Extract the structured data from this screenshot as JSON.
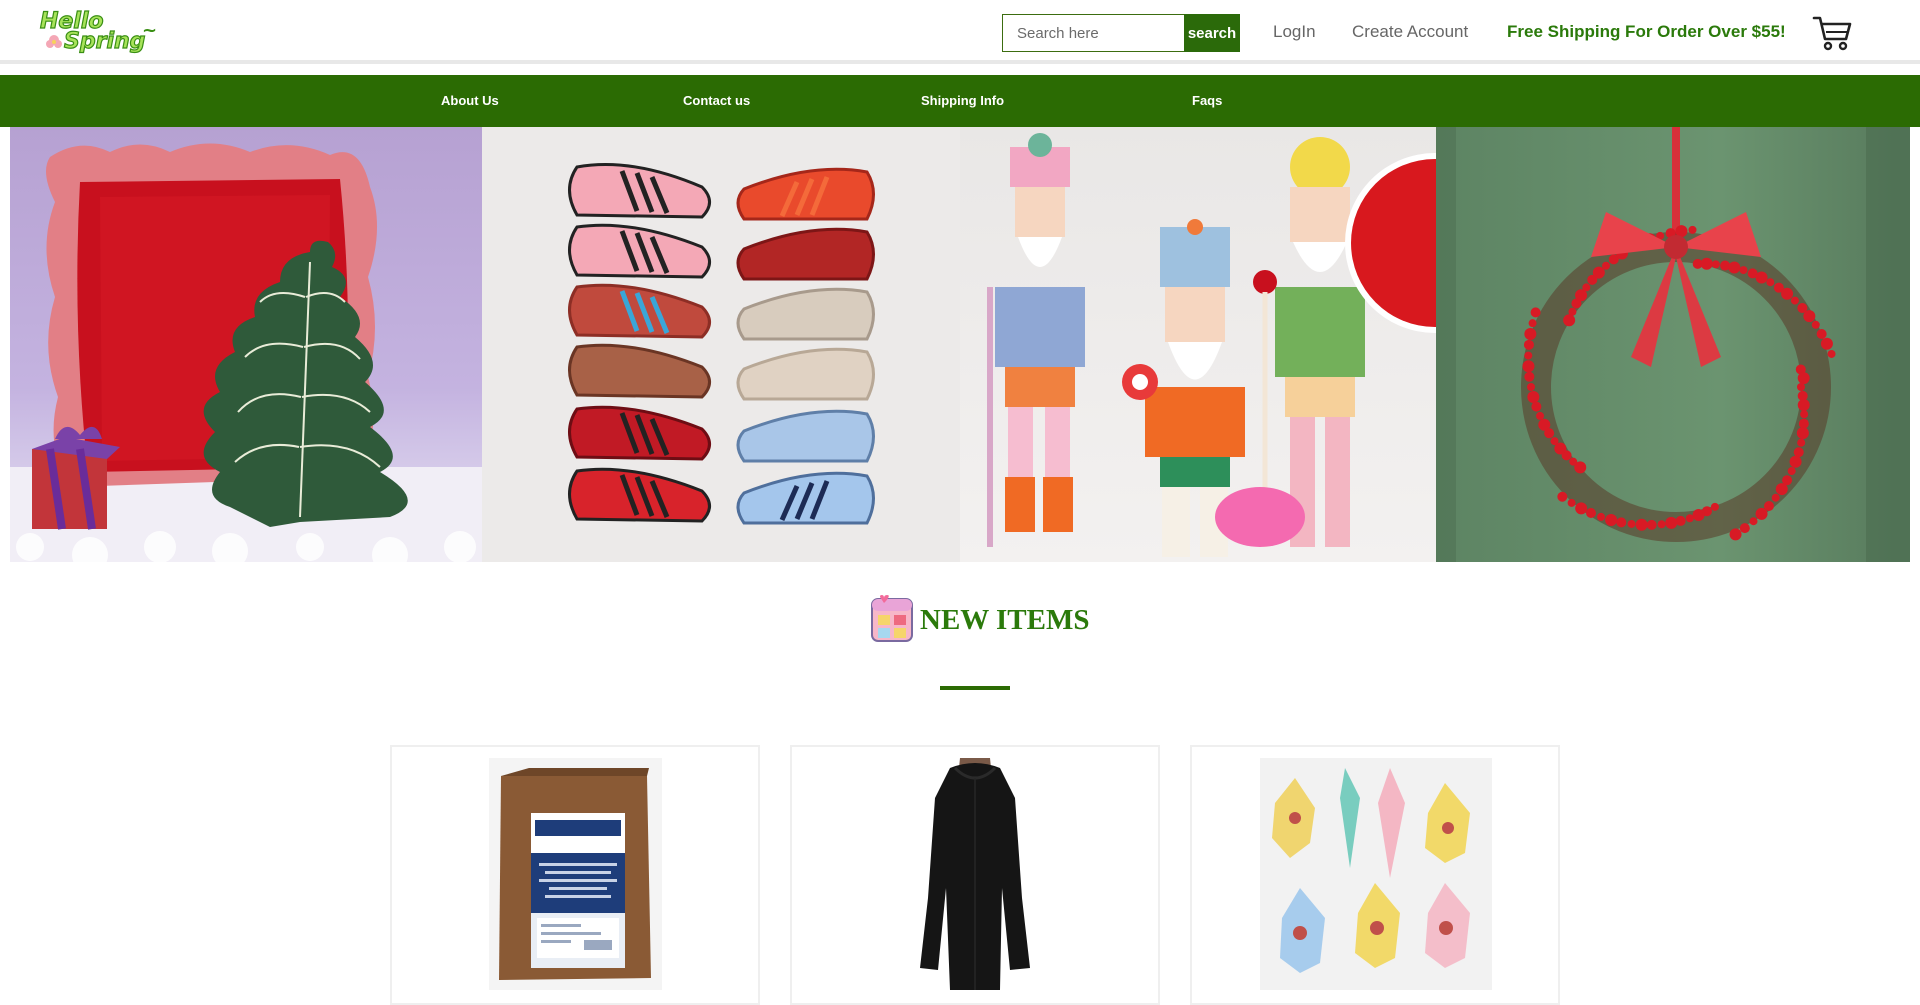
{
  "header": {
    "logo_text": "Hello Spring~",
    "search": {
      "placeholder": "Search here",
      "button_label": "search"
    },
    "login_label": "LogIn",
    "create_account_label": "Create Account",
    "promo_text": "Free Shipping For Order Over $55!",
    "cart_icon": "shopping-cart-icon"
  },
  "nav": {
    "items": [
      {
        "label": "About Us"
      },
      {
        "label": "Contact us"
      },
      {
        "label": "Shipping Info"
      },
      {
        "label": "Faqs"
      }
    ]
  },
  "banner": {
    "panels": [
      {
        "subject": "red velvet pillow with christmas tree cushion"
      },
      {
        "subject": "grid of retro sneakers"
      },
      {
        "subject": "nutcracker figurines"
      },
      {
        "subject": "red berry wreath on green door"
      }
    ]
  },
  "new_items": {
    "title": "NEW ITEMS",
    "icon": "calendar-heart-icon",
    "products": [
      {
        "image": "bradford white gas valve box"
      },
      {
        "image": "black hooded long sleeve top"
      },
      {
        "image": "vintage glass christmas ornaments"
      }
    ]
  },
  "colors": {
    "brand_green": "#2b6b03",
    "promo_green": "#2b7a0b"
  }
}
